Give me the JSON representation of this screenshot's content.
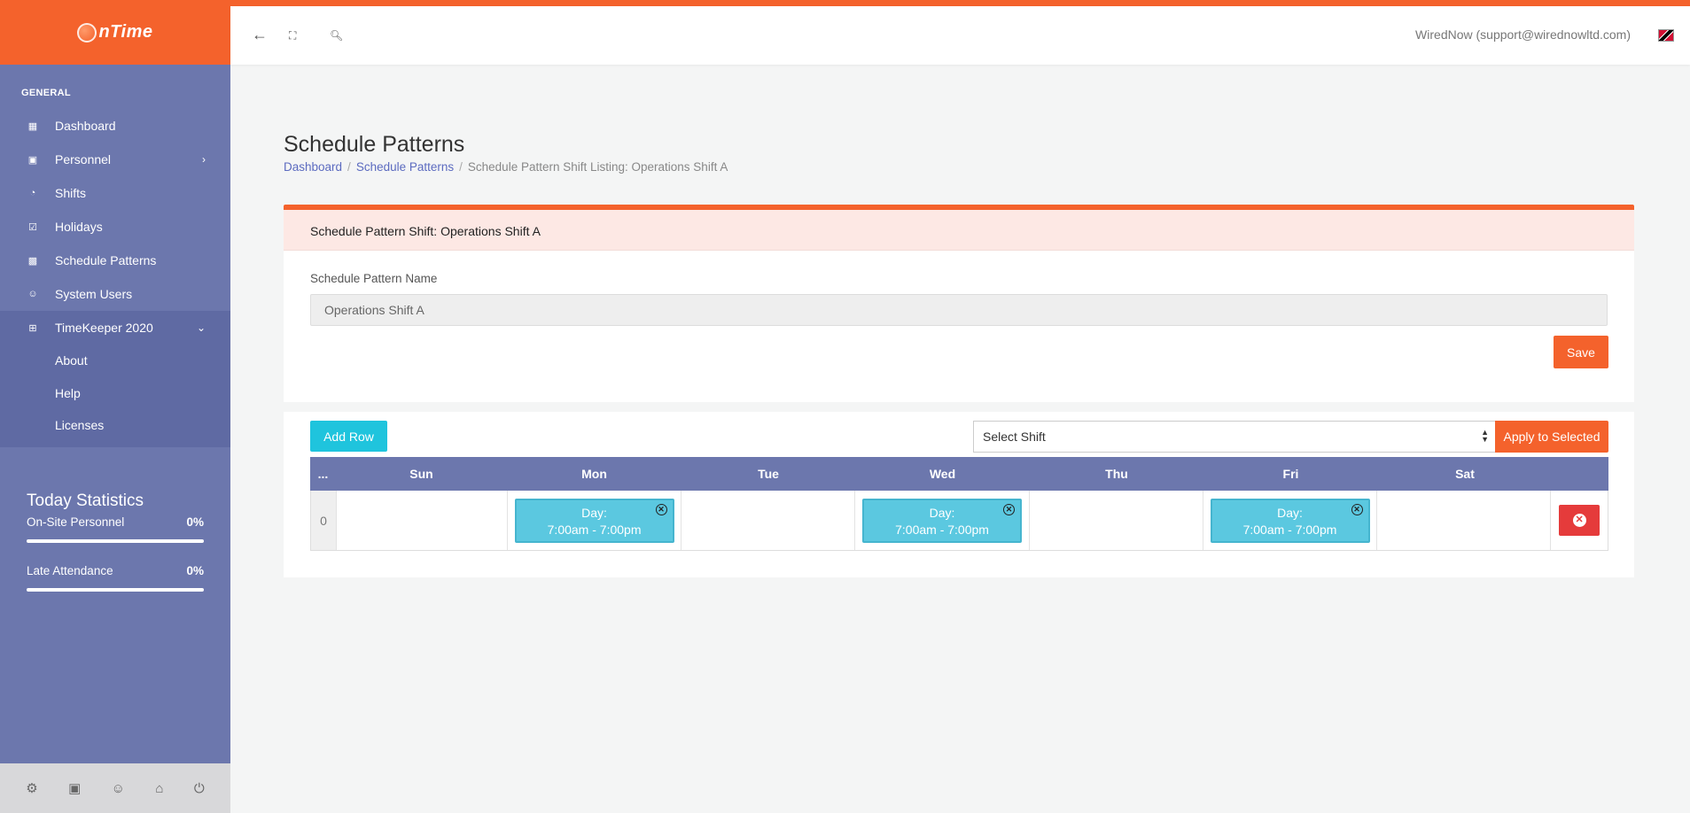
{
  "app": {
    "logo_text": "nTime"
  },
  "topbar": {
    "user": "WiredNow (support@wirednowltd.com)"
  },
  "sidebar": {
    "section": "GENERAL",
    "items": [
      {
        "label": "Dashboard",
        "icon": "dashboard-icon"
      },
      {
        "label": "Personnel",
        "icon": "id-card-icon"
      },
      {
        "label": "Shifts",
        "icon": "pie-icon"
      },
      {
        "label": "Holidays",
        "icon": "calendar-check-icon"
      },
      {
        "label": "Schedule Patterns",
        "icon": "calendar-icon"
      },
      {
        "label": "System Users",
        "icon": "users-icon"
      },
      {
        "label": "TimeKeeper 2020",
        "icon": "plus-box-icon"
      }
    ],
    "submenu": [
      "About",
      "Help",
      "Licenses"
    ],
    "stats": {
      "title": "Today Statistics",
      "onsite_label": "On-Site Personnel",
      "onsite_value": "0%",
      "late_label": "Late Attendance",
      "late_value": "0%"
    }
  },
  "page": {
    "title": "Schedule Patterns",
    "breadcrumb": [
      "Dashboard",
      "Schedule Patterns",
      "Schedule Pattern Shift Listing: Operations Shift A"
    ]
  },
  "form": {
    "header": "Schedule Pattern Shift: Operations Shift A",
    "name_label": "Schedule Pattern Name",
    "name_value": "Operations Shift A",
    "save_label": "Save"
  },
  "grid": {
    "add_row_label": "Add Row",
    "select_value": "Select Shift",
    "apply_label": "Apply to Selected",
    "columns": [
      "...",
      "Sun",
      "Mon",
      "Tue",
      "Wed",
      "Thu",
      "Fri",
      "Sat"
    ],
    "rows": [
      {
        "index": "0",
        "mon": {
          "name": "Day:",
          "time": "7:00am - 7:00pm"
        },
        "wed": {
          "name": "Day:",
          "time": "7:00am - 7:00pm"
        },
        "fri": {
          "name": "Day:",
          "time": "7:00am - 7:00pm"
        }
      }
    ]
  },
  "colors": {
    "accent": "#f4622c",
    "sidebar": "#6c77ad",
    "shift": "#5bc8e0",
    "danger": "#e53b3b"
  }
}
